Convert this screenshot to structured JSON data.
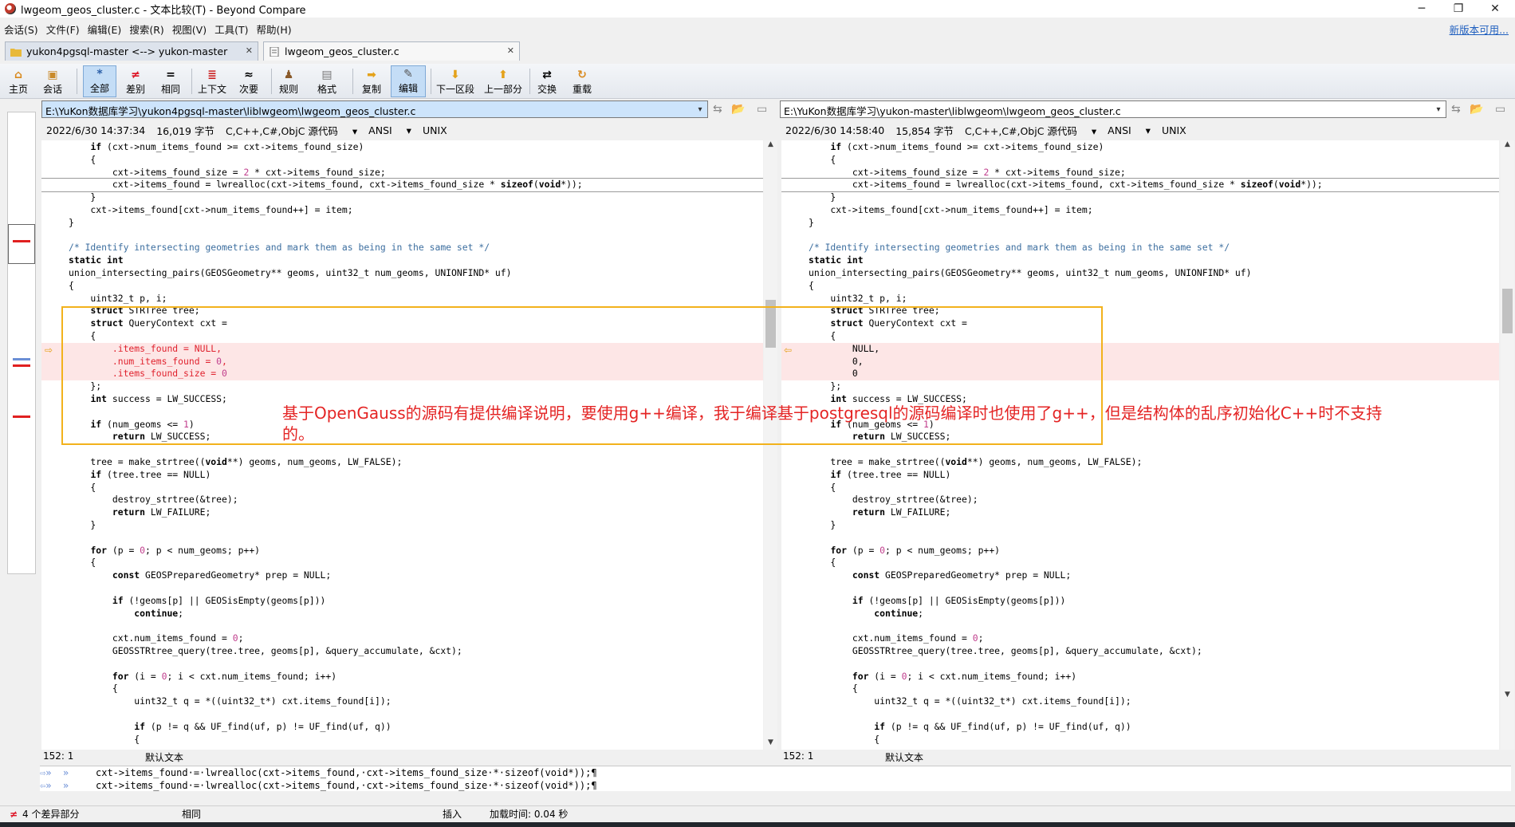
{
  "window": {
    "title": "lwgeom_geos_cluster.c - 文本比较(T) - Beyond Compare"
  },
  "menu": [
    "会话(S)",
    "文件(F)",
    "编辑(E)",
    "搜索(R)",
    "视图(V)",
    "工具(T)",
    "帮助(H)"
  ],
  "new_version": "新版本可用...",
  "tabs": [
    {
      "label": "yukon4pgsql-master <--> yukon-master"
    },
    {
      "label": "lwgeom_geos_cluster.c"
    }
  ],
  "toolbar": [
    "主页",
    "会话",
    "全部",
    "差别",
    "相同",
    "上下文",
    "次要",
    "规则",
    "格式",
    "复制",
    "编辑",
    "下一区段",
    "上一部分",
    "交换",
    "重载"
  ],
  "left": {
    "path": "E:\\YuKon数据库学习\\yukon4pgsql-master\\liblwgeom\\lwgeom_geos_cluster.c",
    "date": "2022/6/30 14:37:34",
    "size": "16,019 字节",
    "format": "C,C++,C#,ObjC 源代码",
    "encoding": "ANSI",
    "eol": "UNIX",
    "pos": "152: 1",
    "mode": "默认文本"
  },
  "right": {
    "path": "E:\\YuKon数据库学习\\yukon-master\\liblwgeom\\lwgeom_geos_cluster.c",
    "date": "2022/6/30 14:58:40",
    "size": "15,854 字节",
    "format": "C,C++,C#,ObjC 源代码",
    "encoding": "ANSI",
    "eol": "UNIX",
    "pos": "152: 1",
    "mode": "默认文本"
  },
  "left_code": [
    "    if (cxt->num_items_found >= cxt->items_found_size)",
    "    {",
    "        cxt->items_found_size = 2 * cxt->items_found_size;",
    "        cxt->items_found = lwrealloc(cxt->items_found, cxt->items_found_size * sizeof(void*));",
    "    }",
    "    cxt->items_found[cxt->num_items_found++] = item;",
    "}",
    "",
    "/* Identify intersecting geometries and mark them as being in the same set */",
    "static int",
    "union_intersecting_pairs(GEOSGeometry** geoms, uint32_t num_geoms, UNIONFIND* uf)",
    "{",
    "    uint32_t p, i;",
    "    struct STRTree tree;",
    "    struct QueryContext cxt =",
    "    {",
    "        .items_found = NULL,",
    "        .num_items_found = 0,",
    "        .items_found_size = 0",
    "    };",
    "    int success = LW_SUCCESS;",
    "",
    "    if (num_geoms <= 1)",
    "        return LW_SUCCESS;",
    "",
    "    tree = make_strtree((void**) geoms, num_geoms, LW_FALSE);",
    "    if (tree.tree == NULL)",
    "    {",
    "        destroy_strtree(&tree);",
    "        return LW_FAILURE;",
    "    }",
    "",
    "    for (p = 0; p < num_geoms; p++)",
    "    {",
    "        const GEOSPreparedGeometry* prep = NULL;",
    "",
    "        if (!geoms[p] || GEOSisEmpty(geoms[p]))",
    "            continue;",
    "",
    "        cxt.num_items_found = 0;",
    "        GEOSSTRtree_query(tree.tree, geoms[p], &query_accumulate, &cxt);",
    "",
    "        for (i = 0; i < cxt.num_items_found; i++)",
    "        {",
    "            uint32_t q = *((uint32_t*) cxt.items_found[i]);",
    "",
    "            if (p != q && UF_find(uf, p) != UF_find(uf, q))",
    "            {"
  ],
  "right_code": [
    "    if (cxt->num_items_found >= cxt->items_found_size)",
    "    {",
    "        cxt->items_found_size = 2 * cxt->items_found_size;",
    "        cxt->items_found = lwrealloc(cxt->items_found, cxt->items_found_size * sizeof(void*));",
    "    }",
    "    cxt->items_found[cxt->num_items_found++] = item;",
    "}",
    "",
    "/* Identify intersecting geometries and mark them as being in the same set */",
    "static int",
    "union_intersecting_pairs(GEOSGeometry** geoms, uint32_t num_geoms, UNIONFIND* uf)",
    "{",
    "    uint32_t p, i;",
    "    struct STRTree tree;",
    "    struct QueryContext cxt =",
    "    {",
    "        NULL,",
    "        0,",
    "        0",
    "    };",
    "    int success = LW_SUCCESS;",
    "",
    "    if (num_geoms <= 1)",
    "        return LW_SUCCESS;",
    "",
    "    tree = make_strtree((void**) geoms, num_geoms, LW_FALSE);",
    "    if (tree.tree == NULL)",
    "    {",
    "        destroy_strtree(&tree);",
    "        return LW_FAILURE;",
    "    }",
    "",
    "    for (p = 0; p < num_geoms; p++)",
    "    {",
    "        const GEOSPreparedGeometry* prep = NULL;",
    "",
    "        if (!geoms[p] || GEOSisEmpty(geoms[p]))",
    "            continue;",
    "",
    "        cxt.num_items_found = 0;",
    "        GEOSSTRtree_query(tree.tree, geoms[p], &query_accumulate, &cxt);",
    "",
    "        for (i = 0; i < cxt.num_items_found; i++)",
    "        {",
    "            uint32_t q = *((uint32_t*) cxt.items_found[i]);",
    "",
    "            if (p != q && UF_find(uf, p) != UF_find(uf, q))",
    "            {"
  ],
  "bottom_lines": [
    "cxt->items_found·=·lwrealloc(cxt->items_found,·cxt->items_found_size·*·sizeof(void*));¶",
    "cxt->items_found·=·lwrealloc(cxt->items_found,·cxt->items_found_size·*·sizeof(void*));¶"
  ],
  "status": {
    "diffs": "4 个差异部分",
    "same": "相同",
    "insert": "插入",
    "load_time": "加载时间: 0.04 秒"
  },
  "annotation": "基于OpenGauss的源码有提供编译说明，要使用g++编译，我于编译基于postgresql的源码编译时也使用了g++，但是结构体的乱序初始化C++时不支持的。",
  "colors": {
    "accent_box": "#f2b21c",
    "annotation_text": "#e42424",
    "diff_bg": "#fde6e6"
  }
}
